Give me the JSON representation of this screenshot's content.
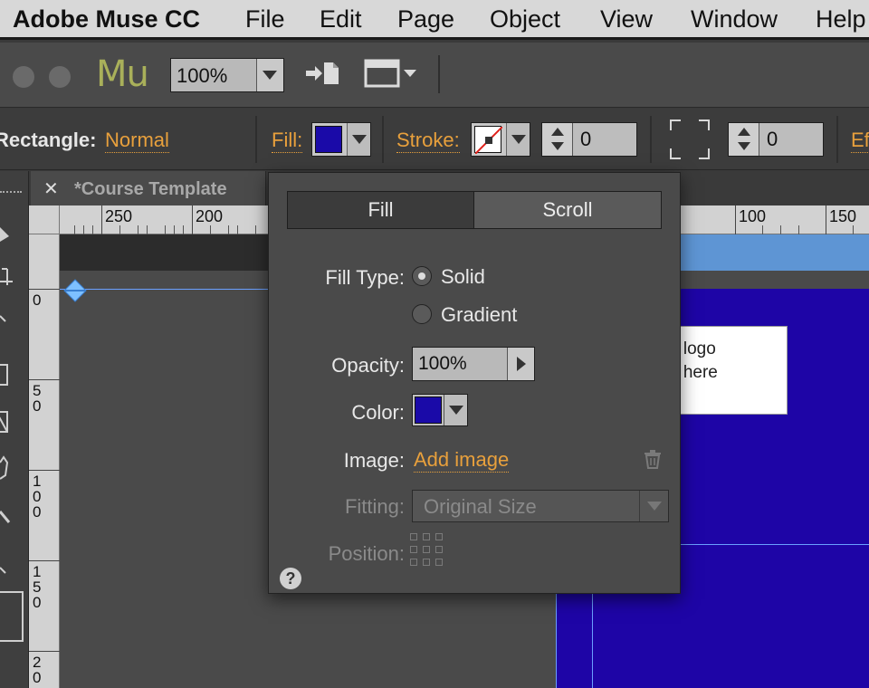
{
  "menu": {
    "app": "Adobe Muse CC",
    "items": [
      "File",
      "Edit",
      "Page",
      "Object",
      "View",
      "Window",
      "Help"
    ]
  },
  "toolbar": {
    "logo": "Mu",
    "zoom": "100%"
  },
  "control_bar": {
    "element_label": "Rectangle:",
    "blend_mode": "Normal",
    "fill_label": "Fill:",
    "stroke_label": "Stroke:",
    "stroke_width": "0",
    "corner_radius": "0",
    "effects_label": "Ef"
  },
  "document": {
    "tab_name": "*Course Template"
  },
  "ruler": {
    "h_labels": [
      "250",
      "200",
      "100",
      "150"
    ],
    "v_labels": [
      "0",
      "5\n0",
      "1\n0\n0",
      "1\n5\n0",
      "2\n0"
    ]
  },
  "canvas": {
    "logo_line1": "e logo",
    "logo_line2": "p here"
  },
  "fill_panel": {
    "tab_fill": "Fill",
    "tab_scroll": "Scroll",
    "fill_type_label": "Fill Type:",
    "option_solid": "Solid",
    "option_gradient": "Gradient",
    "opacity_label": "Opacity:",
    "opacity_value": "100%",
    "color_label": "Color:",
    "image_label": "Image:",
    "add_image": "Add image",
    "fitting_label": "Fitting:",
    "fitting_value": "Original Size",
    "position_label": "Position:",
    "help": "?"
  },
  "colors": {
    "fill_color": "#1a0aa8",
    "accent_orange": "#e8a03c",
    "page_blue": "#1e05a6"
  }
}
